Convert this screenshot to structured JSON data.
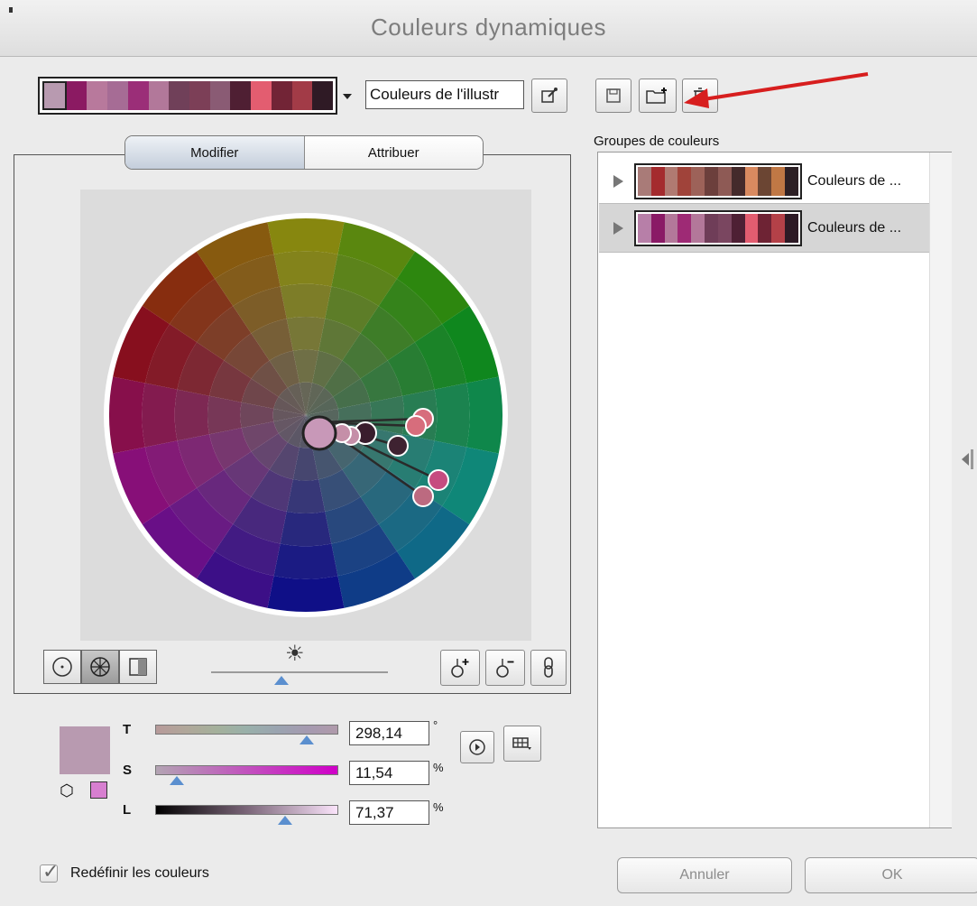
{
  "window": {
    "title": "Couleurs dynamiques"
  },
  "palette": {
    "colors": [
      "#ffffff",
      "#8b1a62",
      "#b8799c",
      "#a66c95",
      "#9b2e78",
      "#b2789a",
      "#704059",
      "#7c3f57",
      "#8a5b74",
      "#4f1f33",
      "#e35d70",
      "#722436",
      "#a23b47",
      "#2f1a25"
    ],
    "group_name": "Couleurs de l'illustr"
  },
  "tabs": {
    "modify": "Modifier",
    "assign": "Attribuer"
  },
  "groups": {
    "label": "Groupes de couleurs",
    "items": [
      {
        "name": "Couleurs de ...",
        "colors": [
          "#a97b78",
          "#a42b2e",
          "#b07a72",
          "#a0433a",
          "#9d6259",
          "#6c3f3c",
          "#8e5a55",
          "#442a2b",
          "#d98a60",
          "#6b4533",
          "#c07845",
          "#2d2025"
        ]
      },
      {
        "name": "Couleurs de ...",
        "colors": [
          "#b77fa8",
          "#8a1a66",
          "#b3789a",
          "#9e2a75",
          "#b3789a",
          "#6f3d58",
          "#7a4660",
          "#4e2034",
          "#e35d70",
          "#6e2334",
          "#b44148",
          "#2d1a25"
        ]
      }
    ]
  },
  "hsl": {
    "h_label": "T",
    "h_value": "298,14",
    "h_unit": "°",
    "s_label": "S",
    "s_value": "11,54",
    "s_unit": "%",
    "l_label": "L",
    "l_value": "71,37",
    "l_unit": "%",
    "h_fraction": 0.83,
    "s_fraction": 0.12,
    "l_fraction": 0.71
  },
  "brightness": {
    "fraction": 0.4
  },
  "footer": {
    "recolor_label": "Redéfinir les couleurs",
    "recolor_checked": true,
    "cancel": "Annuler",
    "ok": "OK"
  },
  "icons": {
    "brightness": "☀",
    "cube": "⬡",
    "play": "▶",
    "link": "🔗",
    "checkmark": "✓"
  },
  "accent_colors": {
    "arrow": "#d71e1e",
    "slider_thumb": "#5b8fcf"
  }
}
